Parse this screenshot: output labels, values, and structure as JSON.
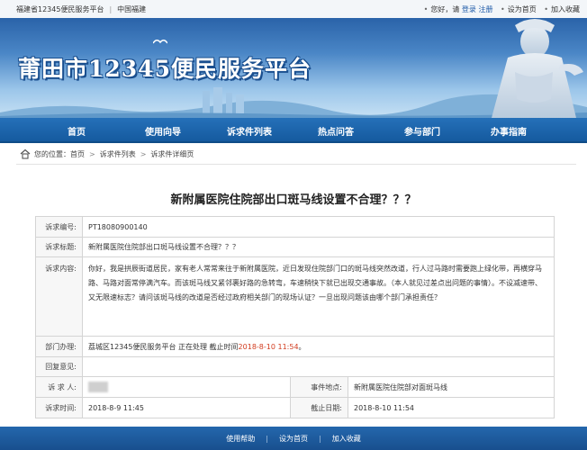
{
  "topbar": {
    "site_name": "福建省12345便民服务平台",
    "portal": "中国福建",
    "greeting": "您好，请",
    "login": "登录",
    "register": "注册",
    "set_home": "设为首页",
    "add_favorite": "加入收藏"
  },
  "banner": {
    "title": "莆田市12345便民服务平台"
  },
  "nav": {
    "items": [
      "首页",
      "使用向导",
      "诉求件列表",
      "热点问答",
      "参与部门",
      "办事指南"
    ]
  },
  "breadcrumb": {
    "prefix": "您的位置：",
    "home": "首页",
    "list": "诉求件列表",
    "detail": "诉求件详细页"
  },
  "page_title": "新附属医院住院部出口斑马线设置不合理？？？",
  "detail": {
    "labels": {
      "id": "诉求编号:",
      "title": "诉求标题:",
      "content": "诉求内容:",
      "dept": "部门办理:",
      "reply": "回复意见:",
      "person": "诉 求 人:",
      "location": "事件地点:",
      "time": "诉求时间:",
      "deadline": "截止日期:"
    },
    "id": "PT18080900140",
    "title": "新附属医院住院部出口斑马线设置不合理？？？",
    "content": "你好，我是拱辰街道居民，家有老人常常来往于新附属医院，近日发现住院部门口的斑马线突然改道，行人过马路时需要跑上绿化带，再横穿马路、马路对面常停满汽车。而该斑马线又紧邻裹好路的急转弯，车速稍快下就已出现交通事故。（本人就见过差点出问题的事情）。不设减速带、又无限速标志？请问该斑马线的改道是否经过政府相关部门的现场认证？一旦出现问题该由哪个部门承担责任？",
    "dept_text": "荔城区12345便民服务平台  正在处理  截止时间",
    "dept_deadline": "2018-8-10 11:54",
    "dept_end": "。",
    "reply": "",
    "location": "新附属医院住院部对面斑马线",
    "time": "2018-8-9 11:45",
    "deadline": "2018-8-10 11:54"
  },
  "footer": {
    "help": "使用帮助",
    "set_home": "设为首页",
    "add_favorite": "加入收藏"
  }
}
